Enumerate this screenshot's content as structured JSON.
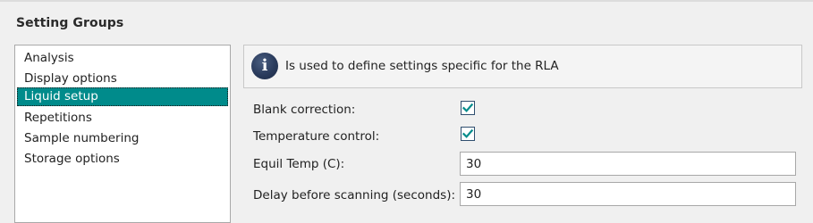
{
  "group": {
    "title": "Setting Groups"
  },
  "list": {
    "items": [
      {
        "label": "Analysis",
        "selected": false
      },
      {
        "label": "Display options",
        "selected": false
      },
      {
        "label": "Liquid setup",
        "selected": true
      },
      {
        "label": "Repetitions",
        "selected": false
      },
      {
        "label": "Sample numbering",
        "selected": false
      },
      {
        "label": "Storage options",
        "selected": false
      }
    ],
    "selected_color": "#008b8b"
  },
  "info": {
    "icon": "info-icon",
    "text": "Is used to define settings specific for the RLA"
  },
  "settings": {
    "blank_correction": {
      "label": "Blank correction:",
      "checked": true
    },
    "temperature_control": {
      "label": "Temperature control:",
      "checked": true
    },
    "equil_temp": {
      "label": "Equil Temp (C):",
      "value": "30"
    },
    "delay_before_scanning": {
      "label": "Delay before scanning (seconds):",
      "value": "30"
    }
  },
  "colors": {
    "check_mark": "#008b8b"
  }
}
